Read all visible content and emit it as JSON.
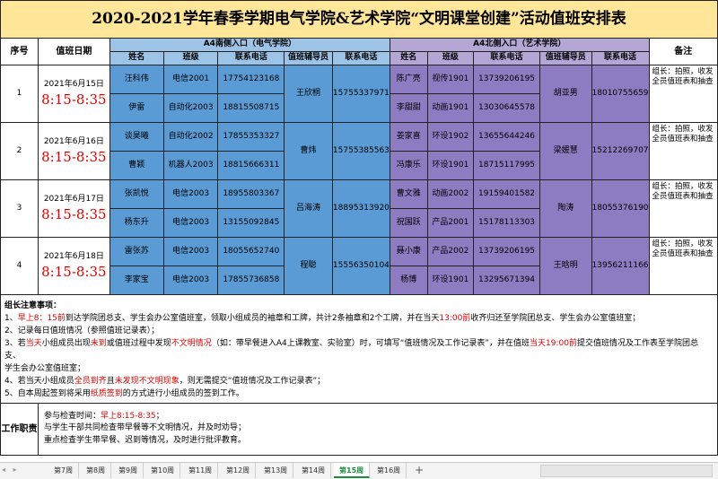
{
  "title": "2020-2021学年春季学期电气学院&艺术学院“文明课堂创建”活动值班安排表",
  "headers": {
    "seq": "序号",
    "date": "值班日期",
    "south_entrance": "A4南侧入口（电气学院）",
    "north_entrance": "A4北侧入口（艺术学院）",
    "remark": "备注",
    "name": "姓名",
    "class": "班级",
    "phone": "联系电话",
    "counselor": "值班辅导员",
    "counselor_phone": "联系电话"
  },
  "rows": [
    {
      "seq": "1",
      "date": "2021年6月15日",
      "time": "8:15-8:35",
      "south": [
        {
          "name": "汪科伟",
          "class": "电信2001",
          "phone": "17754123168"
        },
        {
          "name": "伊雷",
          "class": "自动化2003",
          "phone": "18815508715"
        }
      ],
      "south_counselor": "王欣桐",
      "south_counselor_phone": "15755337971",
      "north": [
        {
          "name": "陈广亮",
          "class": "视传1901",
          "phone": "13739206195"
        },
        {
          "name": "李甜甜",
          "class": "动画1901",
          "phone": "13030645578"
        }
      ],
      "north_counselor": "胡亚男",
      "north_counselor_phone": "18010755659",
      "remark": "组长：拍照，收发全员值班表和抽查"
    },
    {
      "seq": "2",
      "date": "2021年6月16日",
      "time": "8:15-8:35",
      "south": [
        {
          "name": "谈昊曦",
          "class": "自动化2002",
          "phone": "17855353327"
        },
        {
          "name": "曹颖",
          "class": "机器人2003",
          "phone": "18815666311"
        }
      ],
      "south_counselor": "曹炜",
      "south_counselor_phone": "15755385563",
      "north": [
        {
          "name": "姜家喜",
          "class": "环设1902",
          "phone": "13655644246"
        },
        {
          "name": "冯康乐",
          "class": "环设1901",
          "phone": "18715117995"
        }
      ],
      "north_counselor": "梁媛慧",
      "north_counselor_phone": "15212269707",
      "remark": "组长：拍照，收发全员值班表和抽查"
    },
    {
      "seq": "3",
      "date": "2021年6月17日",
      "time": "8:15-8:35",
      "south": [
        {
          "name": "张凯悦",
          "class": "电信2003",
          "phone": "18955803367"
        },
        {
          "name": "杨东升",
          "class": "电信2003",
          "phone": "13155092845"
        }
      ],
      "south_counselor": "吕海涛",
      "south_counselor_phone": "18895313920",
      "north": [
        {
          "name": "曹文雅",
          "class": "动画2002",
          "phone": "19159401582"
        },
        {
          "name": "祝国跃",
          "class": "产品2001",
          "phone": "15178113303"
        }
      ],
      "north_counselor": "陶涛",
      "north_counselor_phone": "18055376190",
      "remark": "组长：拍照，收发全员值班表和抽查"
    },
    {
      "seq": "4",
      "date": "2021年6月18日",
      "time": "8:15-8:35",
      "south": [
        {
          "name": "雷张苏",
          "class": "电信2003",
          "phone": "18055652740"
        },
        {
          "name": "李家宝",
          "class": "电信2003",
          "phone": "17855736858"
        }
      ],
      "south_counselor": "程聪",
      "south_counselor_phone": "15556350104",
      "north": [
        {
          "name": "聂小康",
          "class": "产品2002",
          "phone": "13739206195"
        },
        {
          "name": "杨博",
          "class": "环设1901",
          "phone": "13295671394"
        }
      ],
      "north_counselor": "王晗明",
      "north_counselor_phone": "13956211166",
      "remark": "组长：拍照，收发全员值班表和抽查"
    }
  ],
  "notes": {
    "heading": "组长注意事项：",
    "items": [
      [
        {
          "t": "1、",
          "red": false
        },
        {
          "t": "早上8：15前",
          "red": true
        },
        {
          "t": "到达学院团总支、学生会办公室值班室，领取小组成员的袖章和工牌，共计2条袖章和2个工牌，并在当天",
          "red": false
        },
        {
          "t": "13:00前",
          "red": true
        },
        {
          "t": "收齐归还至学院团总支、学生会办公室值班室；",
          "red": false
        }
      ],
      [
        {
          "t": "2、记录每日值班情况（参照值班记录表）；",
          "red": false
        }
      ],
      [
        {
          "t": "3、若",
          "red": false
        },
        {
          "t": "当天",
          "red": true
        },
        {
          "t": "小组成员出现",
          "red": false
        },
        {
          "t": "未到",
          "red": true
        },
        {
          "t": "或值班过程中发现",
          "red": false
        },
        {
          "t": "不文明情况",
          "red": true
        },
        {
          "t": "（如：带早餐进入A4上课教室、实验室）时，可填写“值班情况及工作记录表”，并在值班",
          "red": false
        },
        {
          "t": "当天19:00前",
          "red": true
        },
        {
          "t": "提交值班情况及工作表至学院团总支、",
          "red": false
        }
      ],
      [
        {
          "t": "学生会办公室值班室；",
          "red": false
        }
      ],
      [
        {
          "t": "4、若当天小组成员",
          "red": false
        },
        {
          "t": "全员到齐",
          "red": true
        },
        {
          "t": "且",
          "red": false
        },
        {
          "t": "未发现不文明现象",
          "red": true
        },
        {
          "t": "，则无需提交“值班情况及工作记录表”；",
          "red": false
        }
      ],
      [
        {
          "t": "5、自本周起签到将采用",
          "red": false
        },
        {
          "t": "纸质签到",
          "red": true
        },
        {
          "t": "的方式进行小组成员的签到工作。",
          "red": false
        }
      ]
    ]
  },
  "duty": {
    "label": "工作职责",
    "lines": [
      [
        {
          "t": "参与检查时间：",
          "red": false
        },
        {
          "t": "早上8:15-8:35",
          "red": true
        },
        {
          "t": "；",
          "red": false
        }
      ],
      [
        {
          "t": "与学生干部共同检查带早餐等不文明情况，并及时劝导；",
          "red": false
        }
      ],
      [
        {
          "t": "重点检查学生带早餐、迟到等情况，及时进行批评教育。",
          "red": false
        }
      ]
    ]
  },
  "sheet_tabs": [
    "第7周",
    "第8周",
    "第9周",
    "第10周",
    "第11周",
    "第12周",
    "第13周",
    "第14周",
    "第15周",
    "第16周"
  ],
  "active_tab": "第15周",
  "colors": {
    "title_bg": "#FFE699",
    "south_bg": "#5B9BD5",
    "north_bg": "#8E7CC3",
    "accent_red": "#E00000",
    "active_tab": "#1E8E3E"
  }
}
